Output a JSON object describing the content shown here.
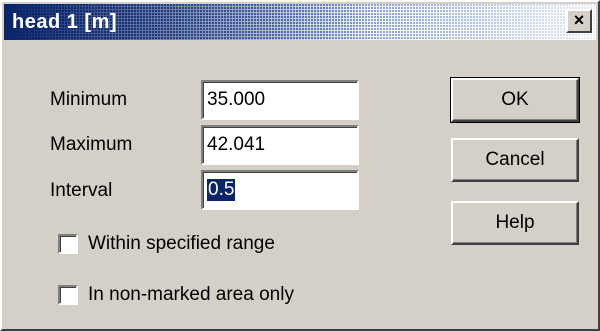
{
  "window": {
    "title": "head 1 [m]",
    "close_symbol": "×"
  },
  "fields": {
    "minimum": {
      "label": "Minimum",
      "value": "35.000"
    },
    "maximum": {
      "label": "Maximum",
      "value": "42.041"
    },
    "interval": {
      "label": "Interval",
      "value": "0.5"
    }
  },
  "options": {
    "within_range": {
      "label": "Within specified range",
      "checked": false
    },
    "non_marked": {
      "label": "In non-marked area only",
      "checked": false
    }
  },
  "buttons": {
    "ok": "OK",
    "cancel": "Cancel",
    "help": "Help"
  },
  "colors": {
    "title_bar": "#0a246a",
    "dialog_face": "#d4d0c8",
    "selection": "#0a246a"
  }
}
